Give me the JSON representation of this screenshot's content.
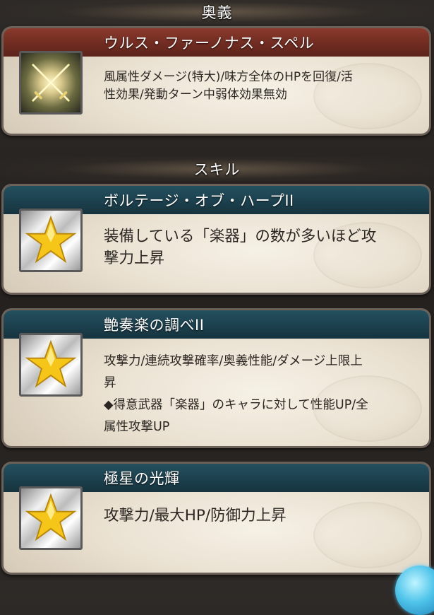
{
  "sections": {
    "ougi_header": "奥義",
    "skill_header": "スキル"
  },
  "ougi": {
    "name": "ウルス・ファーノナス・スペル",
    "description": "風属性ダメージ(特大)/味方全体のHPを回復/活\n性効果/発動ターン中弱体効果無効",
    "icon": "crossed-swords-icon"
  },
  "skills": [
    {
      "name": "ボルテージ・オブ・ハープII",
      "description": "装備している「楽器」の数が多いほど攻\n撃力上昇",
      "icon": "star-icon"
    },
    {
      "name": "艶奏楽の調べII",
      "description": "攻撃力/連続攻撃確率/奥義性能/ダメージ上限上\n昇\n◆得意武器「楽器」のキャラに対して性能UP/全\n属性攻撃UP",
      "icon": "star-icon"
    },
    {
      "name": "極星の光輝",
      "description": "攻撃力/最大HP/防御力上昇",
      "icon": "star-icon"
    }
  ],
  "colors": {
    "ougi_title_bar": "#7a3226",
    "skill_title_bar": "#1f4654",
    "card_background": "#efe8da",
    "star_fill": "#f5c518"
  }
}
